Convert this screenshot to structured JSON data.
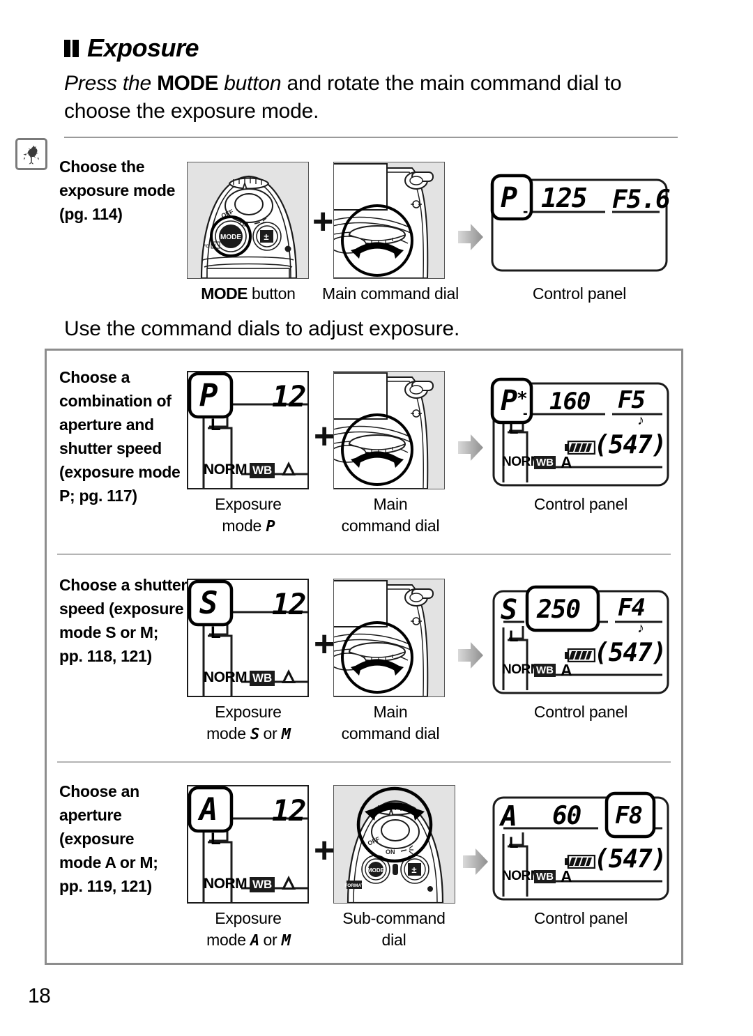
{
  "heading": {
    "title": "Exposure",
    "intro_pre": "Press the ",
    "intro_mode": "MODE",
    "intro_mid": " button",
    "intro_post": " and rotate the main command dial to choose the exposure mode."
  },
  "mid_sentence": "Use the command dials to adjust exposure.",
  "page_number": "18",
  "badge_icon": "rooster-weathervane-icon",
  "steps": [
    {
      "id": "choose-exposure-mode",
      "text_lines": [
        "Choose the",
        "exposure mode",
        "(pg. 114)"
      ],
      "left_caption": {
        "line1": "MODE button",
        "bold_prefix": "MODE",
        "rest": " button"
      },
      "mid_caption": {
        "line1": "Main command dial",
        "line2": ""
      },
      "right_caption": {
        "line1": "Control panel",
        "line2": ""
      },
      "left_art": "camera-top-mode-button",
      "mid_art": "camera-rear-main-command-dial",
      "lcd": {
        "mode": "P",
        "mode_star": "",
        "shutter": "125",
        "aperture": "F5.6",
        "highlight": "mode",
        "show_bottom_row": false,
        "frames": "",
        "battery": false,
        "quality": "",
        "wb": "",
        "size": ""
      }
    },
    {
      "id": "choose-program-combination",
      "text_lines": [
        "Choose a",
        "combination of",
        "aperture and",
        "shutter speed",
        "(exposure mode",
        "P; pg. 117)"
      ],
      "left_caption": {
        "line1": "Exposure",
        "line2": "mode P"
      },
      "mid_caption": {
        "line1": "Main",
        "line2": "command dial"
      },
      "right_caption": {
        "line1": "Control panel",
        "line2": ""
      },
      "left_art": "lcd-mode-only",
      "mid_art": "camera-rear-main-command-dial",
      "left_lcd": {
        "mode": "P",
        "partial": "12",
        "size": "L",
        "quality": "NORM",
        "wb": "WB",
        "wb_mode": "A"
      },
      "lcd": {
        "mode": "P",
        "mode_star": "*",
        "shutter": "160",
        "aperture": "F5",
        "highlight": "mode",
        "show_bottom_row": true,
        "frames": "547",
        "battery": true,
        "quality": "NORM",
        "wb": "WB",
        "size": "L",
        "wb_mode": "A",
        "beep": true
      }
    },
    {
      "id": "choose-shutter-speed",
      "text_lines": [
        "Choose a shutter",
        "speed (exposure",
        "mode S or M;",
        "pp. 118, 121)"
      ],
      "left_caption": {
        "line1": "Exposure",
        "line2": "mode S or M"
      },
      "mid_caption": {
        "line1": "Main",
        "line2": "command dial"
      },
      "right_caption": {
        "line1": "Control panel",
        "line2": ""
      },
      "left_art": "lcd-mode-only",
      "mid_art": "camera-rear-main-command-dial",
      "left_lcd": {
        "mode": "S",
        "partial": "12",
        "size": "L",
        "quality": "NORM",
        "wb": "WB",
        "wb_mode": "A"
      },
      "lcd": {
        "mode": "S",
        "mode_star": "",
        "shutter": "250",
        "aperture": "F4",
        "highlight": "shutter",
        "show_bottom_row": true,
        "frames": "547",
        "battery": true,
        "quality": "NORM",
        "wb": "WB",
        "size": "L",
        "wb_mode": "A",
        "beep": true
      }
    },
    {
      "id": "choose-aperture",
      "text_lines": [
        "Choose an",
        "aperture",
        "(exposure",
        "mode A or M;",
        "pp. 119, 121)"
      ],
      "left_caption": {
        "line1": "Exposure",
        "line2": "mode A or M"
      },
      "mid_caption": {
        "line1": "Sub-command",
        "line2": "dial"
      },
      "right_caption": {
        "line1": "Control panel",
        "line2": ""
      },
      "left_art": "lcd-mode-only",
      "mid_art": "camera-top-sub-command-dial",
      "left_lcd": {
        "mode": "A",
        "partial": "12",
        "size": "L",
        "quality": "NORM",
        "wb": "WB",
        "wb_mode": "A"
      },
      "lcd": {
        "mode": "A",
        "mode_star": "",
        "shutter": "60",
        "aperture": "F8",
        "highlight": "aperture",
        "show_bottom_row": true,
        "frames": "547",
        "battery": true,
        "quality": "NORM",
        "wb": "WB",
        "size": "L",
        "wb_mode": "A",
        "beep": false
      }
    }
  ],
  "symbols": {
    "plus": "+",
    "arrow": "right-arrow-separator"
  }
}
